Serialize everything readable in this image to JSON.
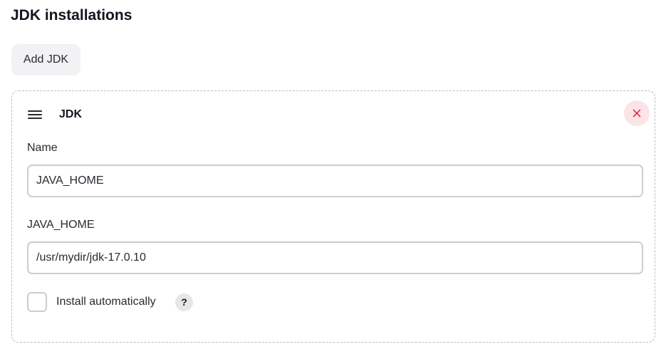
{
  "section": {
    "title": "JDK installations",
    "add_button_label": "Add JDK"
  },
  "jdk_card": {
    "title": "JDK",
    "drag_icon": "hamburger-menu-icon",
    "delete_icon": "close-icon",
    "fields": {
      "name": {
        "label": "Name",
        "value": "JAVA_HOME"
      },
      "java_home": {
        "label": "JAVA_HOME",
        "value": "/usr/mydir/jdk-17.0.10"
      }
    },
    "install_automatically": {
      "label": "Install automatically",
      "checked": false,
      "help_label": "?"
    }
  },
  "colors": {
    "delete_bg": "#fbe4e7",
    "delete_icon": "#e0314f",
    "button_bg": "#f2f2f5",
    "input_border": "#c9ced3",
    "card_border": "#b8bcc2"
  }
}
